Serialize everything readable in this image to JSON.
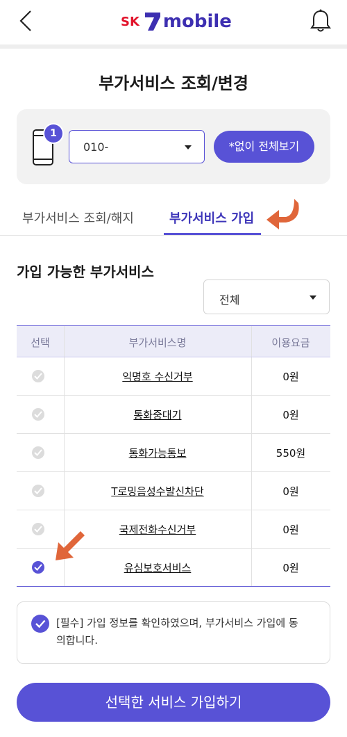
{
  "header": {
    "logo_prefix": "SK",
    "logo_mark": "7",
    "logo_word": "mobile",
    "back_icon": "chevron-left-icon",
    "bell_icon": "bell-icon"
  },
  "page_title": "부가서비스 조회/변경",
  "line_selector": {
    "badge_count": "1",
    "phone_number": "010-",
    "view_all_label": "*없이 전체보기"
  },
  "tabs": [
    {
      "label": "부가서비스 조회/해지",
      "active": false
    },
    {
      "label": "부가서비스 가입",
      "active": true
    }
  ],
  "section_title": "가입 가능한 부가서비스",
  "filter": {
    "selected": "전체"
  },
  "table": {
    "headers": {
      "select": "선택",
      "name": "부가서비스명",
      "fee": "이용요금"
    },
    "rows": [
      {
        "name": "익명호 수신거부",
        "fee": "0원",
        "checked": false
      },
      {
        "name": "통화중대기",
        "fee": "0원",
        "checked": false
      },
      {
        "name": "통화가능통보",
        "fee": "550원",
        "checked": false
      },
      {
        "name": "T로밍음성수발신차단",
        "fee": "0원",
        "checked": false
      },
      {
        "name": "국제전화수신거부",
        "fee": "0원",
        "checked": false
      },
      {
        "name": "유심보호서비스",
        "fee": "0원",
        "checked": true
      }
    ]
  },
  "agreement": {
    "text": "[필수] 가입 정보를 확인하였으며, 부가서비스 가입에 동의합니다.",
    "checked": true
  },
  "submit_label": "선택한 서비스 가입하기",
  "colors": {
    "accent": "#5852d6",
    "arrow": "#e0663a",
    "brand_red": "#e2132b",
    "brand_purple": "#3d2fb1"
  }
}
